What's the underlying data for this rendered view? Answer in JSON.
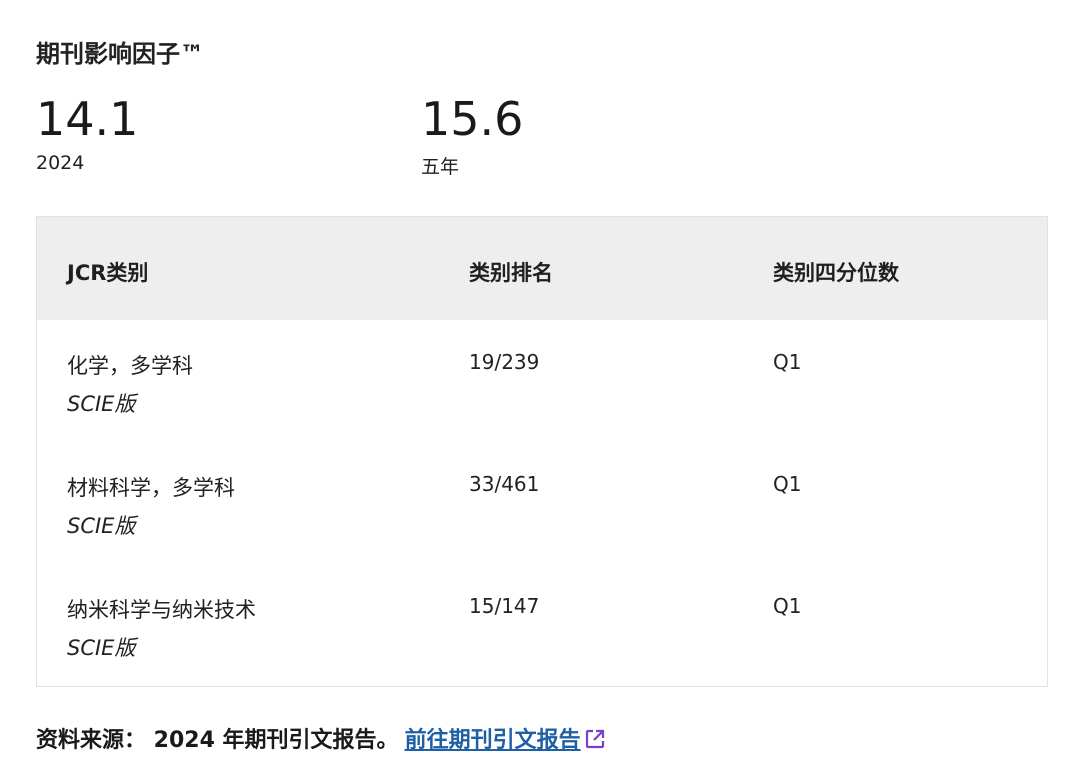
{
  "section": {
    "title": "期刊影响因子™"
  },
  "metrics": [
    {
      "value": "14.1",
      "label": "2024"
    },
    {
      "value": "15.6",
      "label": "五年"
    }
  ],
  "table": {
    "headers": [
      "JCR类别",
      "类别排名",
      "类别四分位数"
    ],
    "rows": [
      {
        "category": "化学，多学科",
        "edition": "SCIE版",
        "rank": "19/239",
        "quartile": "Q1"
      },
      {
        "category": "材料科学，多学科",
        "edition": "SCIE版",
        "rank": "33/461",
        "quartile": "Q1"
      },
      {
        "category": "纳米科学与纳米技术",
        "edition": "SCIE版",
        "rank": "15/147",
        "quartile": "Q1"
      }
    ]
  },
  "footer": {
    "source_text": "资料来源： 2024 年期刊引文报告。",
    "link_label": "前往期刊引文报告",
    "link_icon": "external-link-icon",
    "link_color": "#1f5fa6",
    "icon_color": "#7a3fd1"
  }
}
